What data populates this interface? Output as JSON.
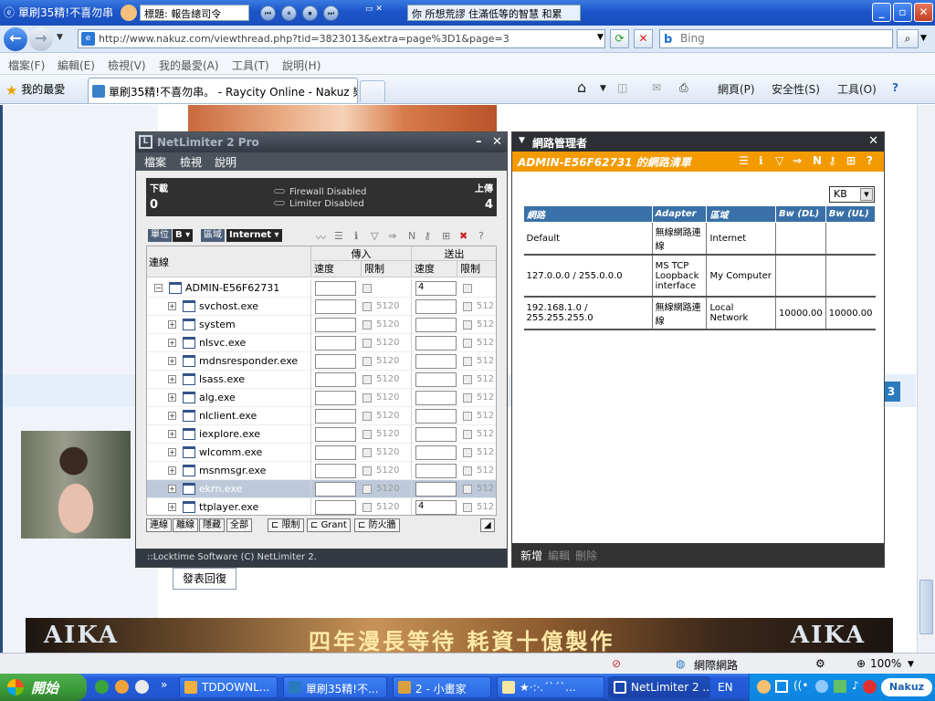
{
  "ie": {
    "title_left": "單刷35精!不喜勿串",
    "title_mid": "標題: 報告總司令",
    "title_right": "你 所想荒謬  住滿低等的智慧 和累",
    "address": "http://www.nakuz.com/viewthread.php?tid=3823013&extra=page%3D1&page=3",
    "search_placeholder": "Bing",
    "menu": [
      "檔案(F)",
      "編輯(E)",
      "檢視(V)",
      "我的最愛(A)",
      "工具(T)",
      "說明(H)"
    ],
    "favorites": "我的最愛",
    "tab_title": "單刷35精!不喜勿串。 - Raycity Online - Nakuz 樂古...",
    "toolbar": {
      "page": "網頁(P)",
      "safety": "安全性(S)",
      "tools": "工具(O)"
    }
  },
  "page": {
    "reply_button": "發表回復",
    "page_badge": "3",
    "banner_left": "AIKA",
    "banner_mid": "四年漫長等待 耗資十億製作",
    "banner_right": "AIKA"
  },
  "status": {
    "zone": "網際網路",
    "zoom": "100%"
  },
  "netlimiter": {
    "title": "NetLimiter 2 Pro",
    "menu": [
      "檔案",
      "檢視",
      "說明"
    ],
    "download_label": "下載",
    "upload_label": "上傳",
    "download_value": "0",
    "upload_value": "4",
    "firewall": "Firewall Disabled",
    "limiter": "Limiter Disabled",
    "unit_label": "單位",
    "unit_value": "B",
    "zone_label": "區域",
    "zone_value": "Internet",
    "columns": {
      "connection": "連線",
      "incoming": "傳入",
      "outgoing": "送出",
      "speed": "速度",
      "limit": "限制"
    },
    "root": "ADMIN-E56F62731",
    "root_out_value": "4",
    "processes": [
      {
        "name": "svchost.exe",
        "in_limit": "5120",
        "out_limit": "512",
        "out_value": ""
      },
      {
        "name": "system",
        "in_limit": "5120",
        "out_limit": "512",
        "out_value": ""
      },
      {
        "name": "nlsvc.exe",
        "in_limit": "5120",
        "out_limit": "512",
        "out_value": ""
      },
      {
        "name": "mdnsresponder.exe",
        "in_limit": "5120",
        "out_limit": "512",
        "out_value": ""
      },
      {
        "name": "lsass.exe",
        "in_limit": "5120",
        "out_limit": "512",
        "out_value": ""
      },
      {
        "name": "alg.exe",
        "in_limit": "5120",
        "out_limit": "512",
        "out_value": ""
      },
      {
        "name": "nlclient.exe",
        "in_limit": "5120",
        "out_limit": "512",
        "out_value": ""
      },
      {
        "name": "iexplore.exe",
        "in_limit": "5120",
        "out_limit": "512",
        "out_value": ""
      },
      {
        "name": "wlcomm.exe",
        "in_limit": "5120",
        "out_limit": "512",
        "out_value": ""
      },
      {
        "name": "msnmsgr.exe",
        "in_limit": "5120",
        "out_limit": "512",
        "out_value": ""
      },
      {
        "name": "ekrn.exe",
        "in_limit": "5120",
        "out_limit": "512",
        "out_value": ""
      },
      {
        "name": "ttplayer.exe",
        "in_limit": "5120",
        "out_limit": "512",
        "out_value": "4"
      }
    ],
    "tabs": [
      "連線",
      "離線",
      "隱藏",
      "全部"
    ],
    "rule_tabs": [
      "限制",
      "Grant",
      "防火牆"
    ],
    "footer": "::Locktime Software (C) NetLimiter 2."
  },
  "netmanager": {
    "title": "網路管理者",
    "subtitle": "ADMIN-E56F62731 的網路清單",
    "unit": "KB",
    "columns": [
      "網路",
      "Adapter",
      "區域",
      "Bw (DL)",
      "Bw (UL)"
    ],
    "rows": [
      {
        "network": "Default",
        "adapter": "無線網路連線",
        "zone": "Internet",
        "dl": "",
        "ul": ""
      },
      {
        "network": "127.0.0.0 / 255.0.0.0",
        "adapter": "MS TCP Loopback interface",
        "zone": "My Computer",
        "dl": "",
        "ul": ""
      },
      {
        "network": "192.168.1.0 / 255.255.255.0",
        "adapter": "無線網路連線",
        "zone": "Local Network",
        "dl": "10000.00",
        "ul": "10000.00"
      }
    ],
    "footer": {
      "add": "新增",
      "edit": "編輯",
      "delete": "刪除"
    }
  },
  "taskbar": {
    "start": "開始",
    "tasks": [
      "TDDOWNL...",
      "單刷35精!不...",
      "2 - 小畫家",
      "★·:·.ˊˋˊˋ...",
      "NetLimiter 2 ..."
    ],
    "lang": "EN",
    "tray_brand": "Nakuz"
  }
}
